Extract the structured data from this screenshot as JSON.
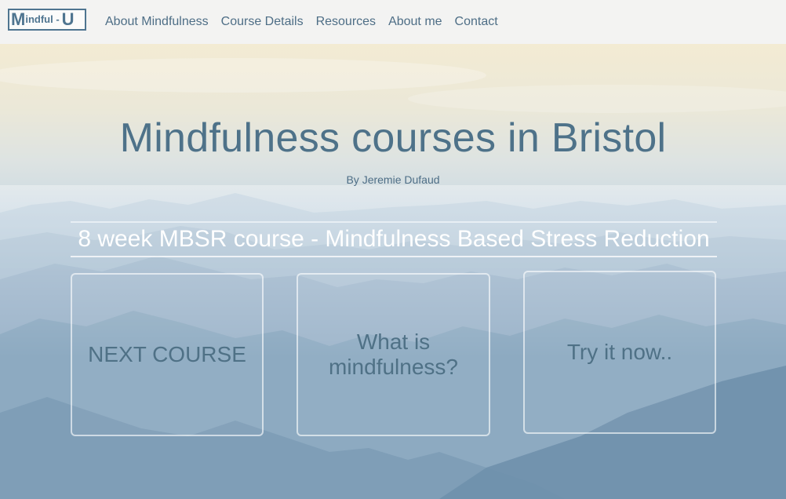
{
  "nav": {
    "logo": {
      "initial": "M",
      "rest": "indful -",
      "suffix": "U"
    },
    "links": [
      "About Mindfulness",
      "Course Details",
      "Resources",
      "About me",
      "Contact"
    ]
  },
  "hero": {
    "title": "Mindfulness courses in Bristol",
    "byline": "By Jeremie Dufaud",
    "course_banner": "8 week MBSR course - Mindfulness Based Stress Reduction"
  },
  "cards": [
    {
      "label": "NEXT COURSE"
    },
    {
      "label": "What is mindfulness?"
    },
    {
      "label": "Try it now.."
    }
  ],
  "colors": {
    "nav_background": "#f3f3f2",
    "nav_text": "#4e6e86",
    "title": "#4e7289",
    "banner_text": "#ffffff",
    "card_text": "#4f7186"
  }
}
